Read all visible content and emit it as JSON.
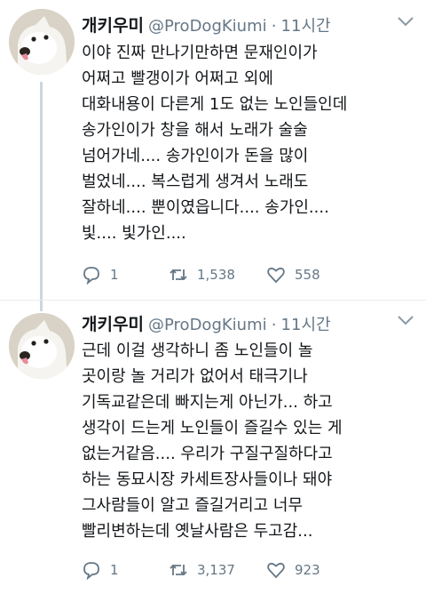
{
  "tweets": [
    {
      "author": {
        "name": "개키우미",
        "handle": "@ProDogKiumi",
        "separator": "·",
        "time": "11시간"
      },
      "text": "이야 진짜 만나기만하면 문재인이가\n어쩌고 빨갱이가 어쩌고 외에\n대화내용이 다른게 1도 없는 노인들인데\n송가인이가 창을 해서 노래가 술술\n넘어가네.... 송가인이가 돈을 많이\n벌었네.... 복스럽게 생겨서 노래도\n잘하네.... 뿐이였읍니다.... 송가인....\n빛.... 빛가인....",
      "replies": "1",
      "retweets": "1,538",
      "likes": "558"
    },
    {
      "author": {
        "name": "개키우미",
        "handle": "@ProDogKiumi",
        "separator": "·",
        "time": "11시간"
      },
      "text": "근데 이걸 생각하니 좀 노인들이 놀\n곳이랑 놀 거리가 없어서 태극기나\n기독교같은데 빠지는게 아닌가... 하고\n생각이 드는게 노인들이 즐길수 있는 게\n없는거같음.... 우리가 구질구질하다고\n하는 동묘시장 카세트장사들이나 돼야\n그사람들이 알고 즐길거리고 너무\n빨리변하는데 옛날사람은 두고감...",
      "replies": "1",
      "retweets": "3,137",
      "likes": "923"
    }
  ],
  "icons": {
    "avatar": "white-dog-avatar",
    "caret": "chevron-down-icon",
    "reply": "reply-icon",
    "retweet": "retweet-icon",
    "like": "heart-icon"
  },
  "colors": {
    "text": "#14171a",
    "secondary": "#657786",
    "thread_line": "#ccd6dd"
  }
}
